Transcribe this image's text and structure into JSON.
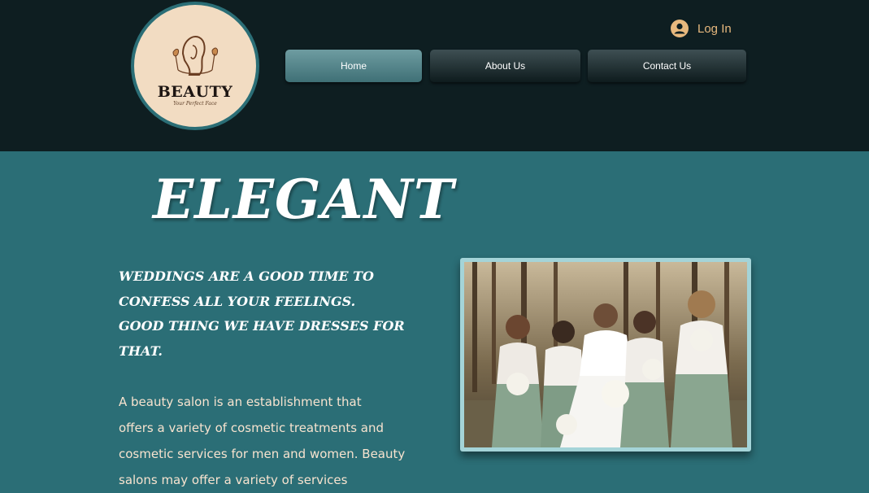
{
  "logo": {
    "title": "BEAUTY",
    "subtitle": "Your Perfect Face",
    "icon": "woman-portrait-icon"
  },
  "header": {
    "login_label": "Log In",
    "login_icon": "user-avatar-icon"
  },
  "nav": {
    "items": [
      {
        "label": "Home",
        "active": true
      },
      {
        "label": "About Us",
        "active": false
      },
      {
        "label": "Contact Us",
        "active": false
      }
    ]
  },
  "hero": {
    "title": "ELEGANT",
    "quote_lines": [
      "WEDDINGS ARE A GOOD TIME TO",
      "CONFESS ALL YOUR FEELINGS.",
      "GOOD THING WE HAVE DRESSES FOR",
      "THAT."
    ],
    "body_lines": [
      "A beauty salon is an establishment that",
      "offers a variety of cosmetic treatments and",
      "cosmetic services for men and women. Beauty",
      "salons may offer a variety of services"
    ],
    "image_icon": "bridal-party-photo"
  },
  "colors": {
    "header_bg": "#0e1e21",
    "page_bg": "#2b6e76",
    "accent": "#e8b97e",
    "logo_bg": "#f2dcc2",
    "body_text": "#f7e3cf",
    "nav_active": "#5a8a90"
  }
}
